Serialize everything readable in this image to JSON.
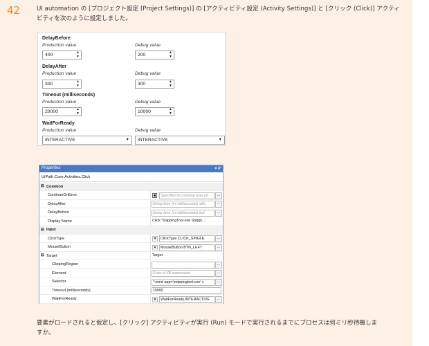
{
  "question": {
    "number": "42",
    "intro_line1": "UI automation の [プロジェクト設定 (Project Settings)] の [アクティビティ設定 (Activity Settings)] と [クリック (Click)] アクティ",
    "intro_line2": "ビティを次のように設定しました。",
    "outro_line1": "要素がロードされると仮定し、[クリック] アクティビティが実行 (Run) モードで実行されるまでにプロセスは何ミリ秒待機しま",
    "outro_line2": "すか。"
  },
  "settings": {
    "production_label": "Production value",
    "debug_label": "Debug value",
    "groups": [
      {
        "title": "DelayBefore",
        "production": "400",
        "debug": "200"
      },
      {
        "title": "DelayAfter",
        "production": "300",
        "debug": "300"
      },
      {
        "title": "Timeout (milliseconds)",
        "production": "20000",
        "debug": "10000"
      },
      {
        "title": "WaitForReady",
        "production": "INTERACTIVE",
        "debug": "INTERACTIVE"
      }
    ]
  },
  "properties": {
    "title": "Properties",
    "window_controls": "▾ ₽",
    "activity": "UiPath.Core.Activities.Click",
    "rows": [
      {
        "kind": "cat",
        "name": "Common",
        "exp": "⊟"
      },
      {
        "kind": "prop",
        "name": "ContinueOnError",
        "value": "Specifies to continue executi",
        "ph": true,
        "chk": true,
        "btn": true
      },
      {
        "kind": "prop",
        "name": "DelayAfter",
        "value": "Delay time (in milliseconds) afte",
        "ph": true,
        "btn": true
      },
      {
        "kind": "prop",
        "name": "DelayBefore",
        "value": "Delay time (in milliseconds) bef",
        "ph": true,
        "btn": true
      },
      {
        "kind": "prop",
        "name": "Display Name",
        "value": "Click 'SnippingTool.exe Snippi...'",
        "ph": false
      },
      {
        "kind": "cat",
        "name": "Input",
        "exp": "⊟"
      },
      {
        "kind": "prop",
        "name": "ClickType",
        "value": "ClickType.CLICK_SINGLE",
        "tri": true,
        "btn": true
      },
      {
        "kind": "prop",
        "name": "MouseButton",
        "value": "MouseButton.BTN_LEFT",
        "tri": true,
        "btn": true
      },
      {
        "kind": "sub",
        "name": "Target",
        "value": "Target",
        "exp": "⊟"
      },
      {
        "kind": "prop2",
        "name": "ClippingRegion",
        "value": "",
        "box": true,
        "btn": true
      },
      {
        "kind": "prop2",
        "name": "Element",
        "value": "Enter a VB expression",
        "ph": true,
        "btn": true
      },
      {
        "kind": "prop2",
        "name": "Selector",
        "value": "\"<wnd app='snippingtool.exe' c",
        "box": true,
        "btn": true
      },
      {
        "kind": "prop2",
        "name": "Timeout (milliseconds)",
        "value": "15000",
        "box": true
      },
      {
        "kind": "prop2",
        "name": "WaitForReady",
        "value": "WaitForReady.INTERACTIVE",
        "tri": true,
        "btn": true
      }
    ]
  }
}
